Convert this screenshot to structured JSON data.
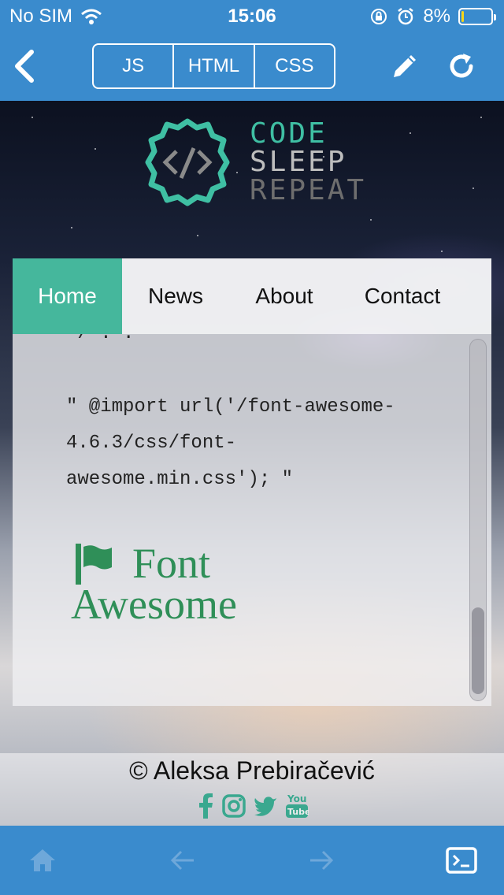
{
  "status_bar": {
    "carrier": "No SIM",
    "time": "15:06",
    "battery": "8%",
    "battery_level": 0.08
  },
  "nav": {
    "tabs": [
      {
        "label": "JS"
      },
      {
        "label": "HTML"
      },
      {
        "label": "CSS"
      }
    ]
  },
  "logo": {
    "line1": "CODE",
    "line2": "SLEEP",
    "line3": "REPEAT"
  },
  "menu": {
    "items": [
      {
        "label": "Home",
        "active": true
      },
      {
        "label": "News",
        "active": false
      },
      {
        "label": "About",
        "active": false
      },
      {
        "label": "Contact",
        "active": false
      }
    ]
  },
  "content": {
    "partial_line": "*/ . .",
    "code": "\" @import url('/font-awesome-4.6.3/css/font-awesome.min.css'); \"",
    "fa_logo_line1": "Font",
    "fa_logo_line2": "Awesome"
  },
  "footer": {
    "copyright": "© Aleksa Prebiračević",
    "socials": [
      "facebook-icon",
      "instagram-icon",
      "twitter-icon",
      "youtube-icon"
    ]
  },
  "colors": {
    "bar_blue": "#3a8bcd",
    "accent_teal": "#45b79c",
    "fa_green": "#2f8f58"
  }
}
